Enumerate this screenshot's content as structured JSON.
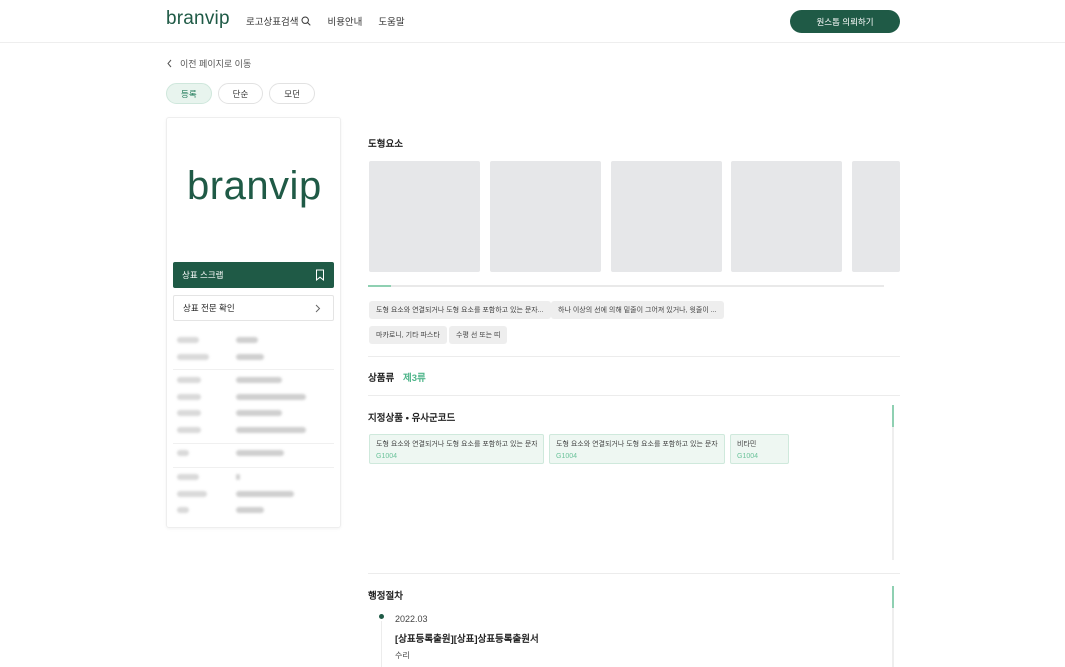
{
  "header": {
    "logo": "branvip",
    "nav": [
      {
        "label": "로고상표검색"
      },
      {
        "label": "비용안내"
      },
      {
        "label": "도움말"
      }
    ],
    "cta_label": "원스톱 의뢰하기",
    "brand_color": "#1f5a46"
  },
  "back_label": "이전 페이지로 이동",
  "tabs": [
    {
      "label": "등록",
      "active": true
    },
    {
      "label": "단순",
      "active": false
    },
    {
      "label": "모던",
      "active": false
    }
  ],
  "card": {
    "logo_text": "branvip",
    "scrap_label": "상표 스크랩",
    "full_text_label": "상표 전문 확인"
  },
  "figure_section": {
    "title": "도형요소",
    "thumbnail_count": 5,
    "chips": [
      "도형 요소와 연결되거나 도형 요소를 포함하고 있는 문자...",
      "하나 이상의 선에 의해 밑줄이 그어져 있거나, 윗줄이 ...",
      "마카로니, 기타 파스타",
      "수평 선 또는 띠"
    ]
  },
  "class_section": {
    "label": "상품류",
    "value": "제3류"
  },
  "goods_section": {
    "title": "지정상품 • 유사군코드",
    "items": [
      {
        "name": "도형 요소와 연결되거나 도형 요소를 포함하고 있는 문자...",
        "code": "G1004"
      },
      {
        "name": "도형 요소와 연결되거나 도형 요소를 포함하고 있는 문자...",
        "code": "G1004"
      },
      {
        "name": "비타민",
        "code": "G1004"
      }
    ]
  },
  "procedure_section": {
    "title": "행정절차",
    "entries": [
      {
        "date": "2022.03",
        "title": "[상표등록출원][상표]상표등록출원서",
        "status": "수리"
      }
    ]
  },
  "colors": {
    "accent": "#1f5a46",
    "accent_light": "#8fd0b2",
    "chip_bg": "#eeeeee",
    "goods_bg": "#eef7f2"
  }
}
